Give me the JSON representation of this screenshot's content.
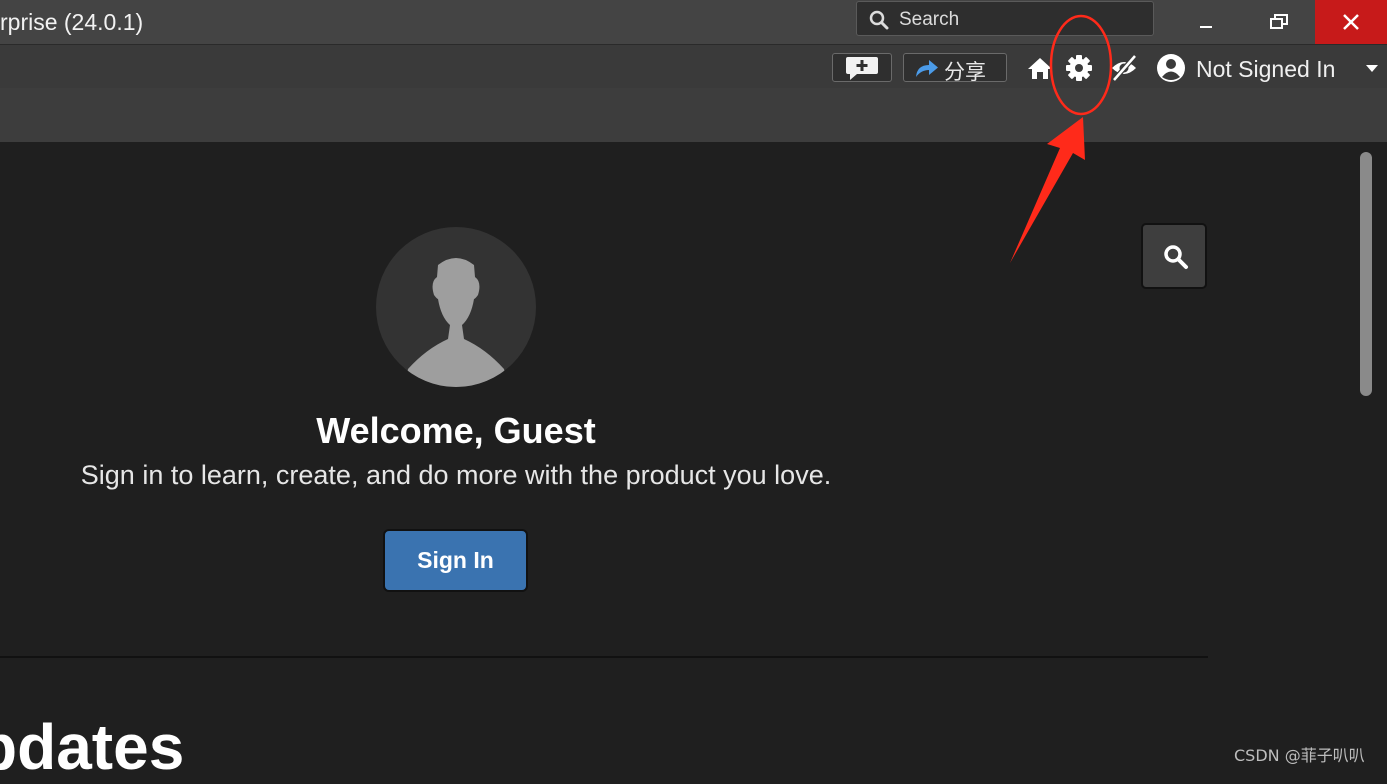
{
  "window": {
    "title": "rprise (24.0.1)",
    "search_placeholder": "Search",
    "controls": [
      "minimize",
      "restore",
      "close"
    ]
  },
  "toolbar": {
    "share_label": "分享",
    "user_label": "Not Signed In",
    "icons": [
      "feedback-icon",
      "share-arrow-icon",
      "home-icon",
      "gear-icon",
      "visibility-off-icon",
      "user-icon",
      "caret-down-icon"
    ]
  },
  "main": {
    "welcome_title": "Welcome, Guest",
    "welcome_subtitle": "Sign in to learn, create, and do more with the product you love.",
    "signin_button": "Sign In",
    "section_title": "pdates"
  },
  "watermark": "CSDN @菲子叭叭",
  "colors": {
    "titlebar_bg": "#444444",
    "toolbar_bg": "#3a3a3a",
    "content_bg": "#1f1f1f",
    "close_red": "#c71a1a",
    "signin_blue": "#3a73b0",
    "annotation_red": "#ff2a1a"
  }
}
